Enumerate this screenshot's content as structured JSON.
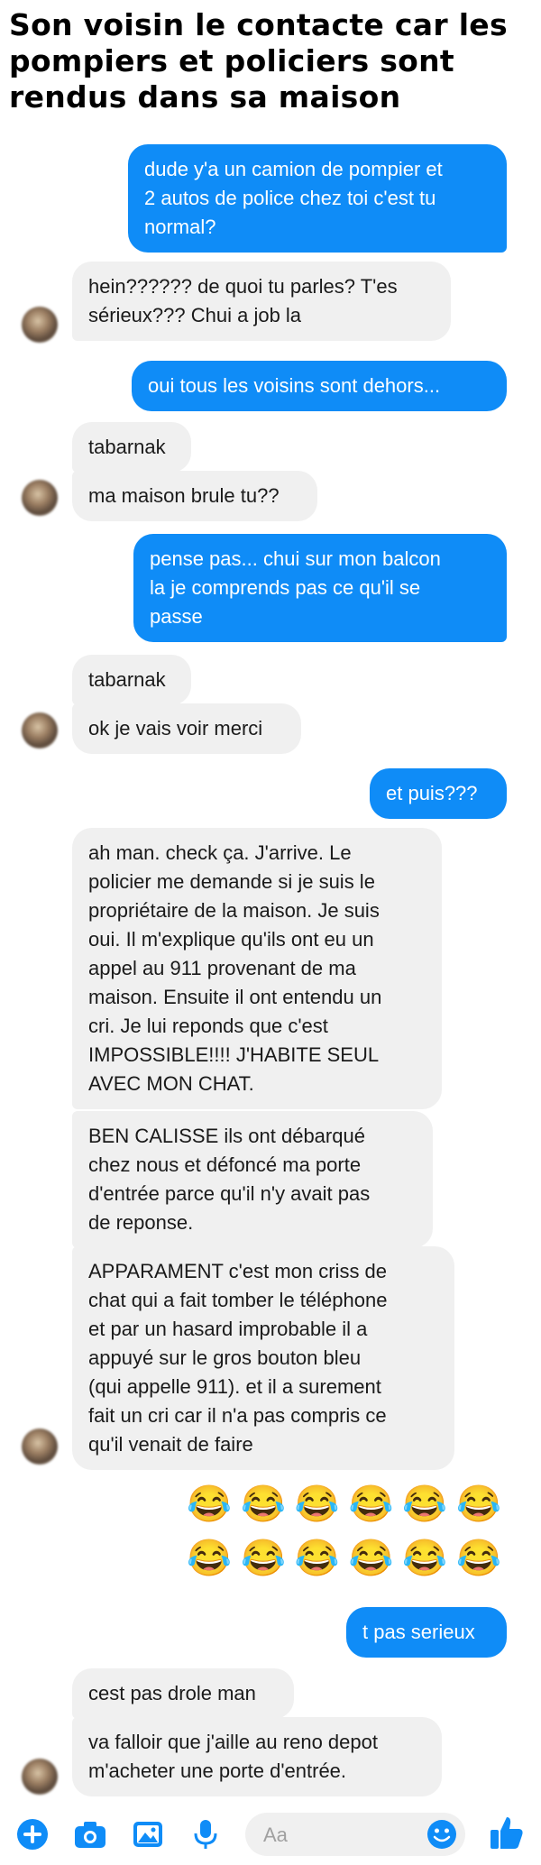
{
  "headline": "Son voisin le contacte car les pompiers et policiers sont rendus dans sa maison",
  "messages": [
    {
      "side": "out",
      "text": "dude y'a un camion de pompier et\n2 autos de police chez toi c'est tu\nnormal?"
    },
    {
      "side": "in",
      "text": "hein?????? de quoi tu parles? T'es\nsérieux??? Chui a job la"
    },
    {
      "side": "out",
      "text": "oui tous les voisins sont dehors..."
    },
    {
      "side": "in",
      "text": "tabarnak"
    },
    {
      "side": "in",
      "text": "ma maison brule tu??"
    },
    {
      "side": "out",
      "text": "pense pas... chui sur mon balcon\nla je comprends pas ce qu'il se\npasse"
    },
    {
      "side": "in",
      "text": "tabarnak"
    },
    {
      "side": "in",
      "text": "ok je vais voir merci"
    },
    {
      "side": "out",
      "text": "et puis???"
    },
    {
      "side": "in",
      "text": "ah man. check ça. J'arrive. Le\npolicier me demande si je suis le\npropriétaire de la maison. Je suis\noui. Il m'explique qu'ils ont eu un\nappel au 911 provenant de ma\nmaison. Ensuite il ont entendu un\ncri. Je lui reponds que c'est\nIMPOSSIBLE!!!! J'HABITE SEUL\nAVEC MON CHAT."
    },
    {
      "side": "in",
      "text": "BEN CALISSE ils ont débarqué\nchez nous et défoncé ma porte\nd'entrée parce qu'il n'y avait pas\nde reponse."
    },
    {
      "side": "in",
      "text": "APPARAMENT c'est mon criss de\nchat qui a fait tomber le téléphone\net par un hasard improbable il a\nappuyé sur le gros bouton bleu\n(qui appelle 911). et il a surement\nfait un cri car il n'a pas compris ce\nqu'il venait de faire"
    },
    {
      "side": "out",
      "text": "t pas serieux"
    },
    {
      "side": "in",
      "text": "cest pas drole man"
    },
    {
      "side": "in",
      "text": "va falloir que j'aille au reno depot\nm'acheter une porte d'entrée."
    }
  ],
  "emoji_rows": [
    "😂😂😂😂😂😂",
    "😂😂😂😂😂😂"
  ],
  "composer": {
    "placeholder": "Aa",
    "icons": [
      "plus-icon",
      "camera-icon",
      "image-icon",
      "microphone-icon",
      "smiley-icon",
      "thumbs-up-icon"
    ]
  },
  "colors": {
    "outgoing": "#0f8cf7",
    "incoming": "#f0f0f0",
    "accent": "#0f8cf7"
  }
}
